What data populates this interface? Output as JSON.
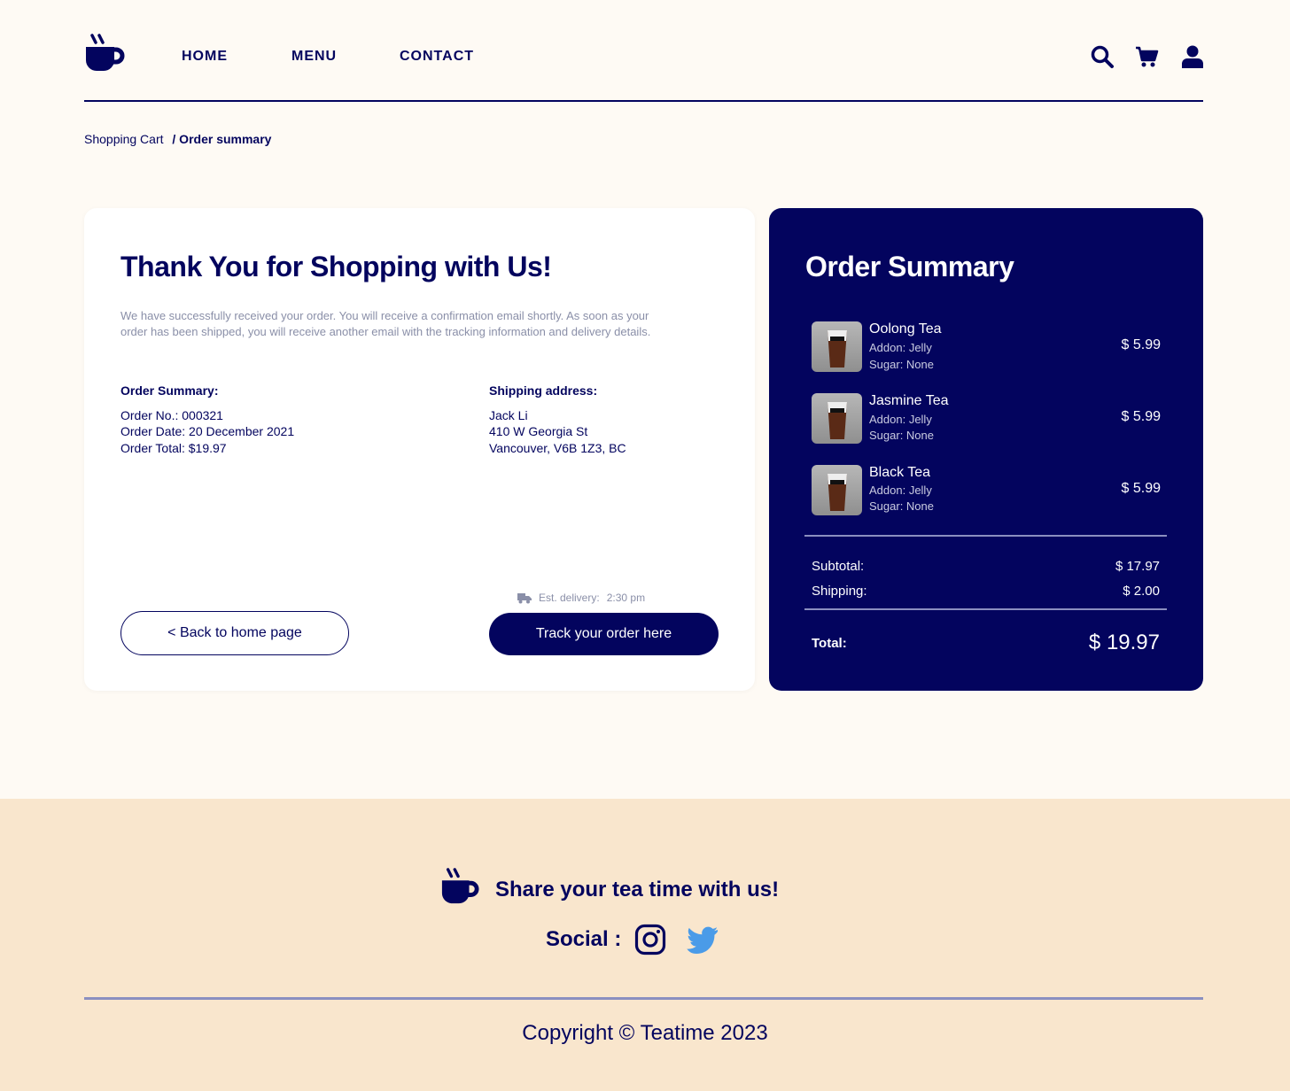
{
  "header": {
    "nav": [
      "HOME",
      "MENU",
      "CONTACT"
    ],
    "icons": [
      "search-icon",
      "cart-icon",
      "user-icon"
    ]
  },
  "breadcrumb": {
    "parent": "Shopping Cart",
    "current": "/ Order summary"
  },
  "confirmation": {
    "title": "Thank You for Shopping with Us!",
    "message": "We have successfully received your order. You will receive a confirmation email shortly. As soon as your order has been shipped, you will receive another email with the tracking information and delivery details.",
    "order_heading": "Order Summary:",
    "order_no": "Order No.: 000321",
    "order_date": "Order Date: 20 December 2021",
    "order_total": "Order Total: $19.97",
    "shipping_heading": "Shipping address:",
    "ship_name": "Jack Li",
    "ship_street": "410 W Georgia St",
    "ship_city": "Vancouver,  V6B 1Z3, BC",
    "est_label": "Est. delivery:",
    "est_time": "2:30 pm",
    "back_label": "< Back to home page",
    "track_label": "Track your order here"
  },
  "summary": {
    "title": "Order Summary",
    "items": [
      {
        "name": "Oolong Tea",
        "addon": "Addon: Jelly",
        "sugar": "Sugar: None",
        "price": "$ 5.99"
      },
      {
        "name": "Jasmine Tea",
        "addon": "Addon: Jelly",
        "sugar": "Sugar: None",
        "price": "$ 5.99"
      },
      {
        "name": "Black Tea",
        "addon": "Addon: Jelly",
        "sugar": "Sugar: None",
        "price": "$ 5.99"
      }
    ],
    "subtotal_label": "Subtotal:",
    "subtotal": "$ 17.97",
    "shipping_label": "Shipping:",
    "shipping": "$ 2.00",
    "total_label": "Total:",
    "total": "$ 19.97"
  },
  "footer": {
    "share": "Share your tea time with us!",
    "social": "Social :",
    "copyright": "Copyright © Teatime 2023"
  },
  "colors": {
    "brand": "#03045e",
    "background": "#fefaf4",
    "footer_bg": "#f9e6cd",
    "twitter": "#4a9be8"
  }
}
